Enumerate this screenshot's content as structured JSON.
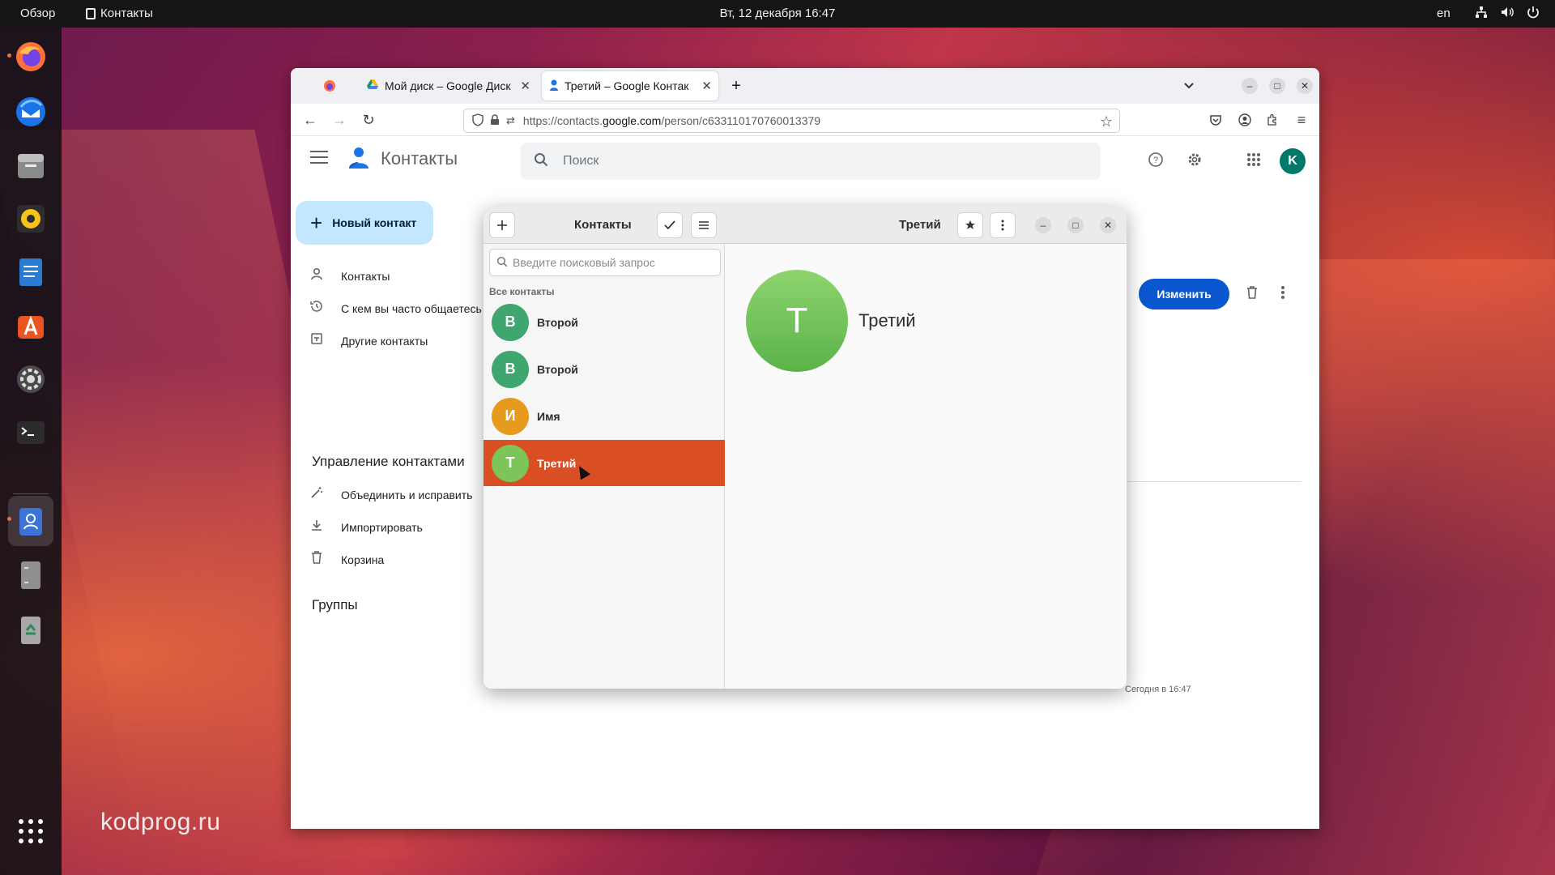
{
  "topbar": {
    "overview": "Обзор",
    "app_name": "Контакты",
    "clock": "Вт, 12 декабря  16:47",
    "lang": "en"
  },
  "dock": {
    "items": [
      "firefox-icon",
      "thunderbird-icon",
      "files-icon",
      "rhythmbox-icon",
      "writer-icon",
      "app-center-icon",
      "settings-icon",
      "terminal-icon",
      "contacts-icon",
      "disks-icon",
      "trash-icon"
    ],
    "show_apps": "apps-grid-icon"
  },
  "watermark": "kodprog.ru",
  "browser": {
    "tabs": [
      {
        "title": "Мой диск – Google Диск"
      },
      {
        "title": "Третий – Google Контак"
      }
    ],
    "new_tab": "+",
    "url_prefix": "https://contacts.",
    "url_host": "google.com",
    "url_path": "/person/c633110170760013379"
  },
  "gcontacts": {
    "title": "Контакты",
    "search_placeholder": "Поиск",
    "avatar_letter": "K",
    "new_contact": "Новый контакт",
    "nav": [
      {
        "label": "Контакты",
        "icon": "person-icon"
      },
      {
        "label": "С кем вы часто общаетесь",
        "icon": "history-icon"
      },
      {
        "label": "Другие контакты",
        "icon": "archive-icon"
      }
    ],
    "manage_title": "Управление контактами",
    "manage": [
      {
        "label": "Объединить и исправить",
        "icon": "magic-wand-icon"
      },
      {
        "label": "Импортировать",
        "icon": "download-icon"
      },
      {
        "label": "Корзина",
        "icon": "trash-icon"
      }
    ],
    "groups_title": "Группы",
    "edit_button": "Изменить",
    "changed_time": "Сегодня в 16:47"
  },
  "gnome_contacts": {
    "list_title": "Контакты",
    "detail_title": "Третий",
    "search_placeholder": "Введите поисковый запрос",
    "group_label": "Все контакты",
    "contacts": [
      {
        "letter": "В",
        "name": "Второй",
        "color": "#3fa66f"
      },
      {
        "letter": "В",
        "name": "Второй",
        "color": "#3fa66f"
      },
      {
        "letter": "И",
        "name": "Имя",
        "color": "#e69a1e"
      },
      {
        "letter": "Т",
        "name": "Третий",
        "color": "#7cc55a"
      }
    ],
    "selected_index": 3,
    "detail": {
      "letter": "Т",
      "name": "Третий"
    }
  },
  "colors": {
    "accent_blue": "#0b57d0",
    "selection_orange": "#d94e23",
    "new_contact_bg": "#c2e7ff"
  }
}
